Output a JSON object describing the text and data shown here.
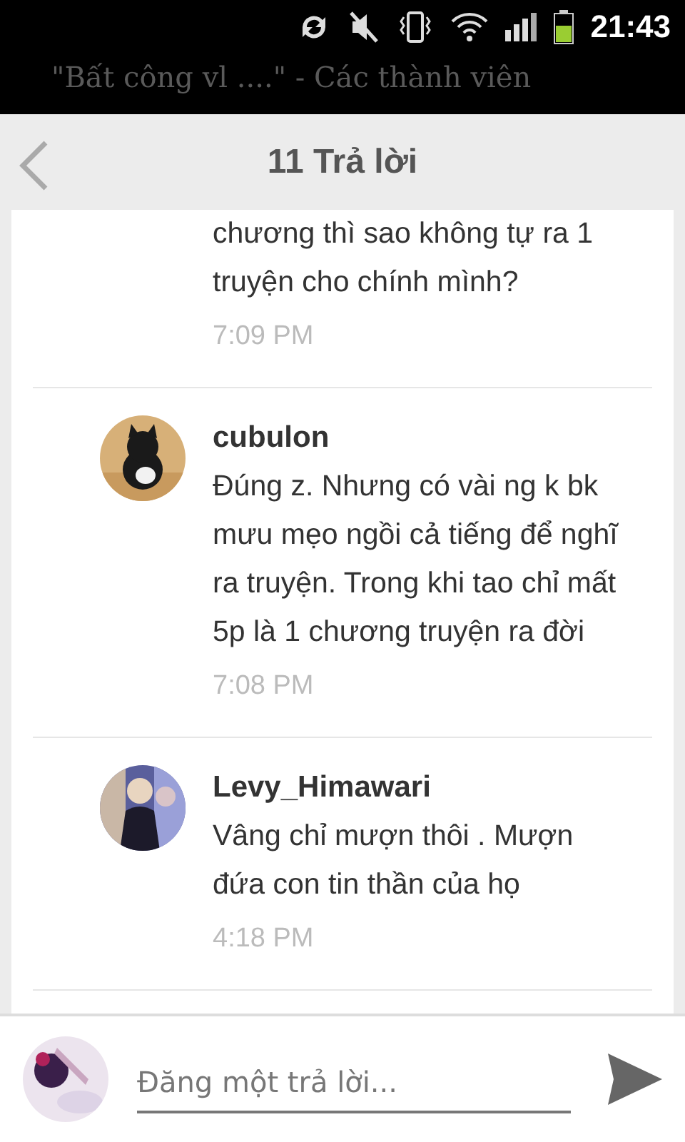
{
  "status_bar": {
    "time": "21:43"
  },
  "background_text": [
    "\"Bất công vl ....\" - Các thành viên"
  ],
  "header": {
    "title": "11 Trả lời"
  },
  "comments": [
    {
      "body": "chương thì sao không tự ra 1 truyện cho chính mình?",
      "time": "7:09 PM"
    },
    {
      "author": "cubulon",
      "body": "Đúng z. Nhưng có vài ng k bk mưu mẹo ngồi cả tiếng để nghĩ ra truyện. Trong khi tao chỉ mất 5p là 1 chương truyện ra đời",
      "time": "7:08 PM"
    },
    {
      "author": "Levy_Himawari",
      "body": "Vâng chỉ mượn thôi . Mượn đứa con tin thần của họ",
      "time": "4:18 PM"
    }
  ],
  "reply": {
    "placeholder": "Đăng một trả lời..."
  }
}
